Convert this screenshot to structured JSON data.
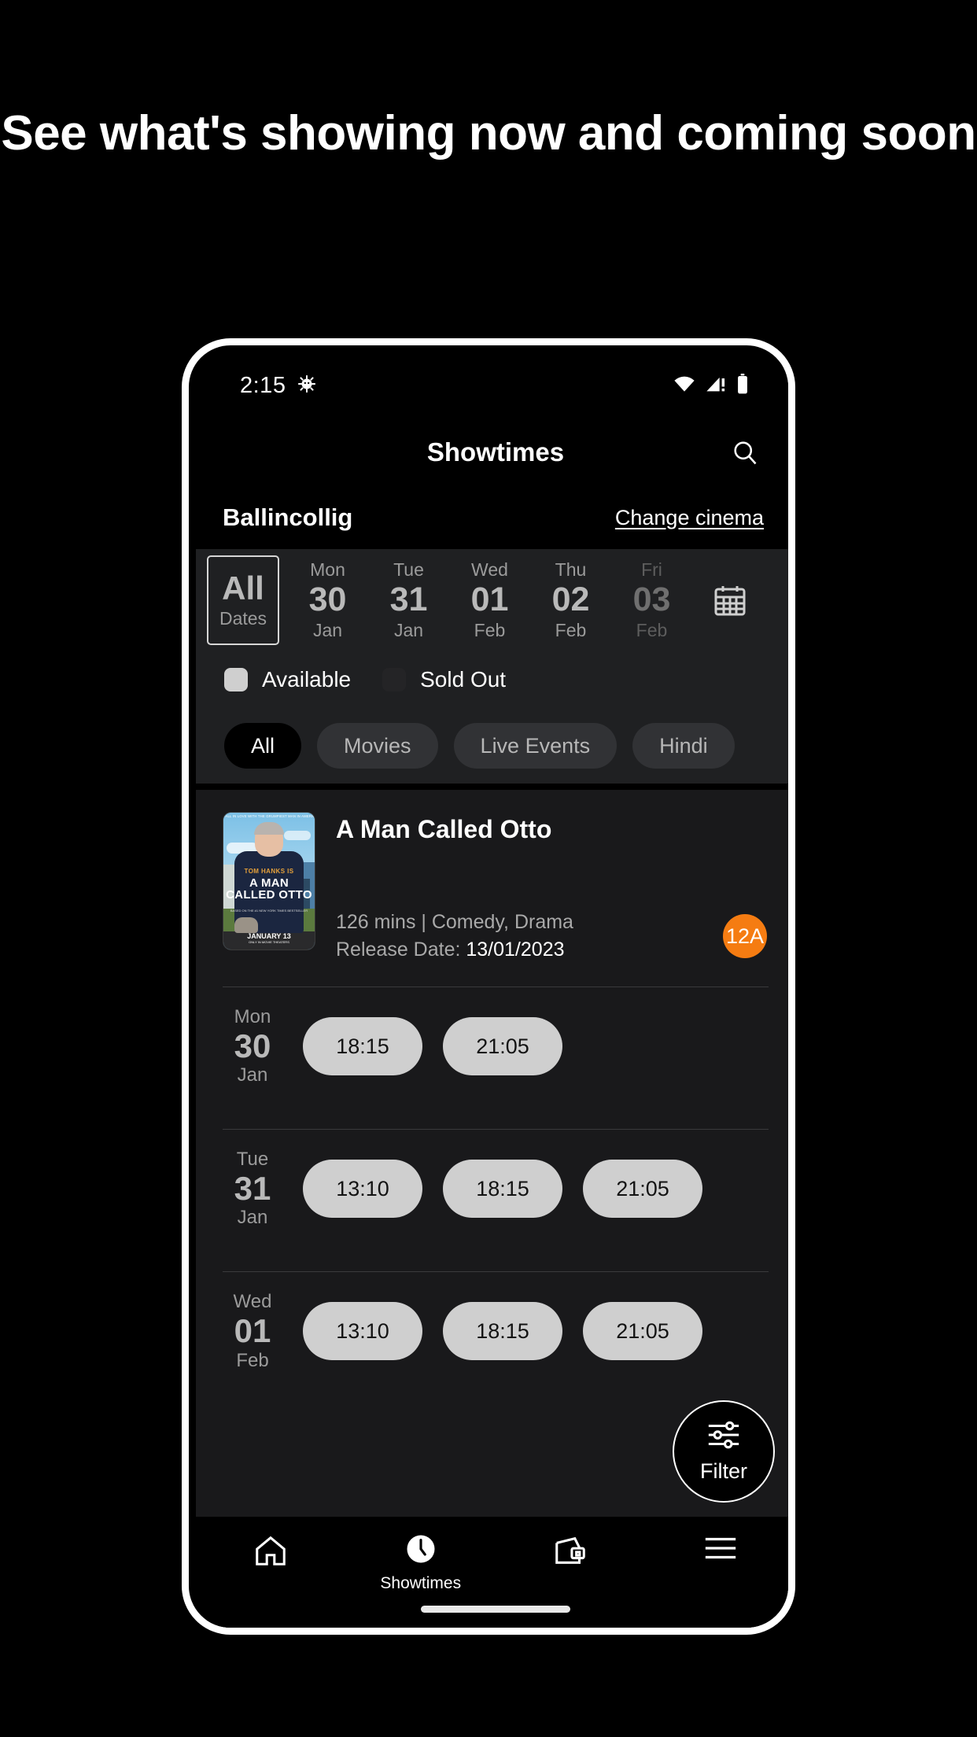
{
  "promo": {
    "headline": "See what's showing now and coming soon"
  },
  "status_bar": {
    "time": "2:15",
    "icons": [
      "bug-icon",
      "wifi-icon",
      "cellular-signal-icon",
      "battery-icon"
    ]
  },
  "app_bar": {
    "title": "Showtimes",
    "search_icon": "search-icon"
  },
  "cinema": {
    "name": "Ballincollig",
    "change_label": "Change cinema"
  },
  "dates": {
    "calendar_icon": "calendar-icon",
    "items": [
      {
        "dow": "All",
        "day": "",
        "mon": "Dates",
        "selected": true,
        "dim": false
      },
      {
        "dow": "Mon",
        "day": "30",
        "mon": "Jan",
        "selected": false,
        "dim": false
      },
      {
        "dow": "Tue",
        "day": "31",
        "mon": "Jan",
        "selected": false,
        "dim": false
      },
      {
        "dow": "Wed",
        "day": "01",
        "mon": "Feb",
        "selected": false,
        "dim": false
      },
      {
        "dow": "Thu",
        "day": "02",
        "mon": "Feb",
        "selected": false,
        "dim": false
      },
      {
        "dow": "Fri",
        "day": "03",
        "mon": "Feb",
        "selected": false,
        "dim": true
      }
    ]
  },
  "legend": [
    {
      "label": "Available",
      "color": "#cfcfcf"
    },
    {
      "label": "Sold Out",
      "color": "#242426"
    }
  ],
  "category_chips": [
    {
      "label": "All",
      "active": true
    },
    {
      "label": "Movies",
      "active": false
    },
    {
      "label": "Live Events",
      "active": false
    },
    {
      "label": "Hindi",
      "active": false
    }
  ],
  "movie": {
    "title": "A Man Called Otto",
    "duration_genre": "126 mins | Comedy, Drama",
    "release_label": "Release Date: ",
    "release_date": "13/01/2023",
    "rating": "12A",
    "rating_color": "#f57c12",
    "poster": {
      "tagline": "FALL IN LOVE WITH THE GRUMPIEST MAN IN AMERICA",
      "star_line": "TOM HANKS IS",
      "title": "A MAN CALLED OTTO",
      "credits": "BASED ON THE #1 NEW YORK TIMES BESTSELLER",
      "release_month": "JANUARY 13",
      "release_sub": "ONLY IN MOVIE THEATERS"
    }
  },
  "showtimes": [
    {
      "dow": "Mon",
      "day": "30",
      "mon": "Jan",
      "times": [
        "18:15",
        "21:05"
      ]
    },
    {
      "dow": "Tue",
      "day": "31",
      "mon": "Jan",
      "times": [
        "13:10",
        "18:15",
        "21:05"
      ]
    },
    {
      "dow": "Wed",
      "day": "01",
      "mon": "Feb",
      "times": [
        "13:10",
        "18:15",
        "21:05"
      ]
    }
  ],
  "fab": {
    "label": "Filter",
    "icon": "sliders-icon"
  },
  "bottom_nav": [
    {
      "label": "",
      "icon": "home-icon",
      "active": false
    },
    {
      "label": "Showtimes",
      "icon": "clock-icon",
      "active": true
    },
    {
      "label": "",
      "icon": "wallet-icon",
      "active": false
    },
    {
      "label": "",
      "icon": "menu-icon",
      "active": false
    }
  ]
}
